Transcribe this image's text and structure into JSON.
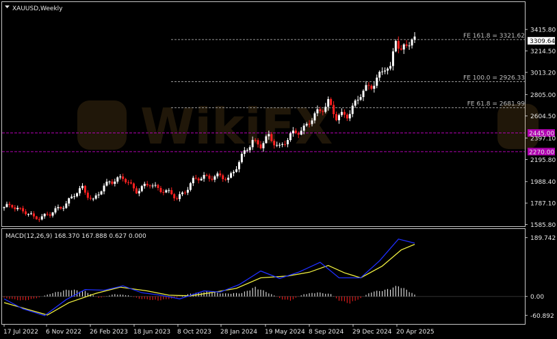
{
  "chart_window": {
    "symbol_title": "XAUUSD,Weekly",
    "indicator_title": "MACD(12,26,9) 168.370 167.888 0.627 0.000"
  },
  "colors": {
    "background": "#000000",
    "bull_candle": "#ffffff",
    "bear_candle": "#ff2020",
    "fe_line": "#9a9a9a",
    "level_line": "#b000b0",
    "level_label_bg": "#b000b0",
    "price_label_bg": "#ffffff",
    "macd_line": "#1f2fff",
    "signal_line": "#f0f040",
    "hist_pos": "#ffffff",
    "hist_neg": "#ff2020"
  },
  "chart_data": [
    {
      "type": "candlestick",
      "title": "XAUUSD,Weekly",
      "ylim": [
        1570,
        3500
      ],
      "price_axis_ticks": [
        "3415.80",
        "3214.50",
        "3013.20",
        "2805.00",
        "2604.50",
        "2397.10",
        "2195.80",
        "1988.40",
        "1787.10",
        "1585.80"
      ],
      "time_axis_ticks": [
        "17 Jul 2022",
        "6 Nov 2022",
        "26 Feb 2023",
        "18 Jun 2023",
        "8 Oct 2023",
        "28 Jan 2024",
        "19 May 2024",
        "8 Sep 2024",
        "29 Dec 2024",
        "20 Apr 2025"
      ],
      "current_price": "3309.64",
      "price_path": [
        [
          "2022-07-10",
          1740
        ],
        [
          "2022-07-31",
          1770
        ],
        [
          "2022-09-25",
          1650
        ],
        [
          "2022-11-06",
          1680
        ],
        [
          "2022-12-18",
          1790
        ],
        [
          "2023-01-29",
          1930
        ],
        [
          "2023-02-26",
          1810
        ],
        [
          "2023-04-09",
          2000
        ],
        [
          "2023-05-14",
          2015
        ],
        [
          "2023-06-18",
          1910
        ],
        [
          "2023-07-23",
          1960
        ],
        [
          "2023-08-27",
          1910
        ],
        [
          "2023-10-01",
          1830
        ],
        [
          "2023-11-12",
          1990
        ],
        [
          "2023-12-10",
          2040
        ],
        [
          "2024-01-14",
          2030
        ],
        [
          "2024-02-11",
          2020
        ],
        [
          "2024-03-10",
          2170
        ],
        [
          "2024-04-14",
          2380
        ],
        [
          "2024-05-05",
          2330
        ],
        [
          "2024-05-26",
          2400
        ],
        [
          "2024-06-23",
          2320
        ],
        [
          "2024-07-28",
          2430
        ],
        [
          "2024-08-25",
          2500
        ],
        [
          "2024-10-06",
          2650
        ],
        [
          "2024-10-27",
          2750
        ],
        [
          "2024-11-17",
          2580
        ],
        [
          "2024-12-15",
          2620
        ],
        [
          "2025-01-19",
          2800
        ],
        [
          "2025-02-16",
          2900
        ],
        [
          "2025-03-23",
          3050
        ],
        [
          "2025-04-06",
          3030
        ],
        [
          "2025-04-20",
          3350
        ],
        [
          "2025-05-04",
          3230
        ],
        [
          "2025-05-18",
          3250
        ],
        [
          "2025-06-01",
          3320
        ],
        [
          "2025-06-08",
          3309.64
        ]
      ],
      "fibonacci_extensions": [
        {
          "label": "FE 161.8 = 3321.62",
          "value": 3321.62
        },
        {
          "label": "FE 100.0 = 2926.33",
          "value": 2926.33
        },
        {
          "label": "FE 61.8 = 2681.99",
          "value": 2681.99
        }
      ],
      "horizontal_levels": [
        {
          "label": "2445.00",
          "value": 2445.0
        },
        {
          "label": "2270.00",
          "value": 2270.0
        }
      ]
    },
    {
      "type": "line",
      "title": "MACD(12,26,9) 168.370 167.888 0.627 0.000",
      "ylim": [
        -80,
        200
      ],
      "axis_ticks": [
        "189.742",
        "0.00",
        "-60.892"
      ],
      "macd_path": [
        [
          "2022-07-10",
          -8
        ],
        [
          "2022-08-28",
          -40
        ],
        [
          "2022-10-23",
          -62
        ],
        [
          "2022-12-18",
          -10
        ],
        [
          "2023-02-05",
          22
        ],
        [
          "2023-03-26",
          20
        ],
        [
          "2023-05-14",
          34
        ],
        [
          "2023-07-02",
          12
        ],
        [
          "2023-08-20",
          4
        ],
        [
          "2023-10-08",
          -8
        ],
        [
          "2023-12-10",
          18
        ],
        [
          "2024-01-21",
          14
        ],
        [
          "2024-03-10",
          38
        ],
        [
          "2024-05-05",
          82
        ],
        [
          "2024-06-23",
          58
        ],
        [
          "2024-08-11",
          78
        ],
        [
          "2024-10-06",
          110
        ],
        [
          "2024-11-24",
          60
        ],
        [
          "2025-01-19",
          60
        ],
        [
          "2025-03-09",
          115
        ],
        [
          "2025-04-27",
          185
        ],
        [
          "2025-06-08",
          172
        ]
      ],
      "signal_path": [
        [
          "2022-07-10",
          -20
        ],
        [
          "2022-09-18",
          -45
        ],
        [
          "2022-10-30",
          -60
        ],
        [
          "2022-12-25",
          -20
        ],
        [
          "2023-03-05",
          10
        ],
        [
          "2023-05-07",
          30
        ],
        [
          "2023-07-16",
          18
        ],
        [
          "2023-09-10",
          4
        ],
        [
          "2023-11-05",
          2
        ],
        [
          "2024-01-07",
          14
        ],
        [
          "2024-03-03",
          26
        ],
        [
          "2024-05-05",
          60
        ],
        [
          "2024-07-14",
          66
        ],
        [
          "2024-09-08",
          78
        ],
        [
          "2024-10-27",
          100
        ],
        [
          "2024-12-08",
          76
        ],
        [
          "2025-01-19",
          60
        ],
        [
          "2025-03-16",
          98
        ],
        [
          "2025-05-04",
          150
        ],
        [
          "2025-06-08",
          168
        ]
      ],
      "histogram_path": [
        [
          "2022-07-10",
          -5
        ],
        [
          "2022-08-28",
          -15
        ],
        [
          "2022-10-02",
          -6
        ],
        [
          "2022-11-13",
          12
        ],
        [
          "2022-12-25",
          24
        ],
        [
          "2023-02-05",
          18
        ],
        [
          "2023-03-12",
          -6
        ],
        [
          "2023-04-23",
          8
        ],
        [
          "2023-05-28",
          4
        ],
        [
          "2023-06-25",
          -8
        ],
        [
          "2023-08-13",
          -14
        ],
        [
          "2023-09-24",
          -6
        ],
        [
          "2023-11-05",
          10
        ],
        [
          "2023-12-17",
          16
        ],
        [
          "2024-02-04",
          10
        ],
        [
          "2024-03-17",
          12
        ],
        [
          "2024-04-21",
          32
        ],
        [
          "2024-05-26",
          12
        ],
        [
          "2024-06-30",
          -10
        ],
        [
          "2024-07-21",
          -14
        ],
        [
          "2024-08-25",
          8
        ],
        [
          "2024-09-29",
          14
        ],
        [
          "2024-11-03",
          8
        ],
        [
          "2024-11-24",
          -14
        ],
        [
          "2024-12-22",
          -24
        ],
        [
          "2025-01-19",
          -6
        ],
        [
          "2025-02-16",
          16
        ],
        [
          "2025-03-23",
          22
        ],
        [
          "2025-04-27",
          37
        ],
        [
          "2025-05-25",
          18
        ],
        [
          "2025-06-08",
          6
        ]
      ]
    }
  ]
}
